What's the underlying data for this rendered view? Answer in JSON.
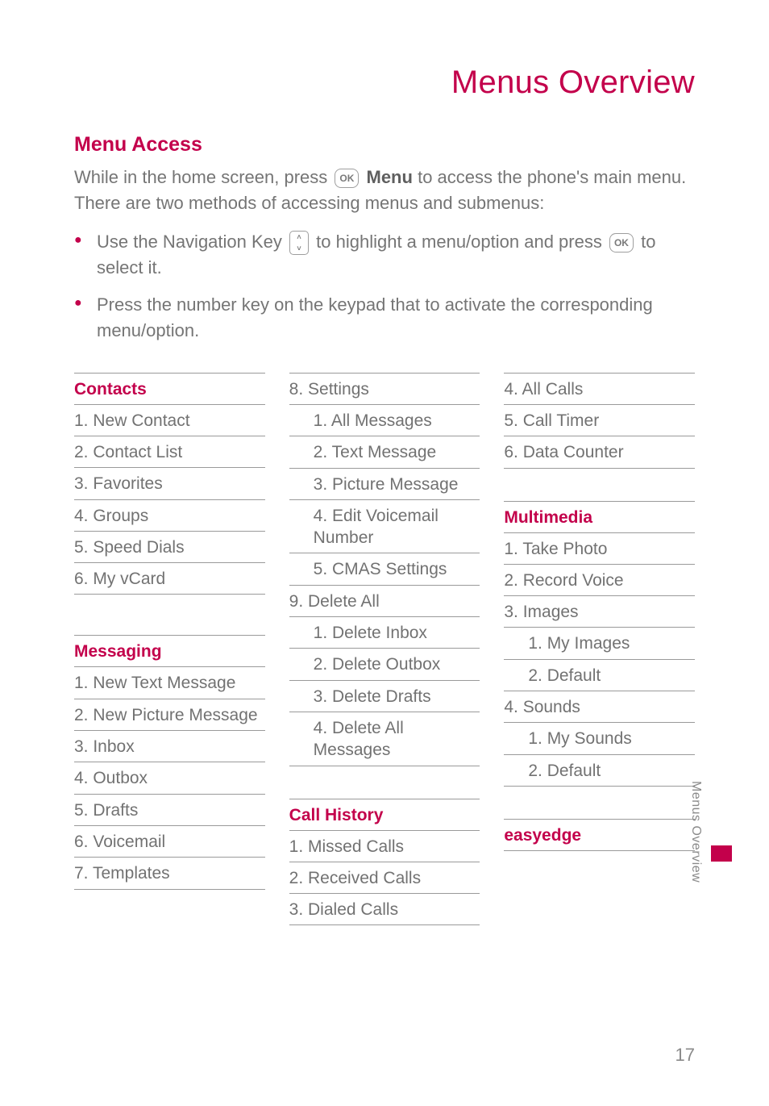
{
  "page": {
    "title": "Menus Overview",
    "section_heading": "Menu Access",
    "intro_before_icon": "While in the home screen, press ",
    "intro_icon_label": "OK",
    "intro_bold": " Menu",
    "intro_after_bold": " to access the phone's main menu. There are two methods of accessing menus and submenus:",
    "bullet1_a": "Use the Navigation Key ",
    "bullet1_b": " to highlight a menu/option and press ",
    "bullet1_c": " to select it.",
    "bullet2": "Press the number key on the keypad that to activate the corresponding menu/option.",
    "side_tab": "Menus Overview",
    "page_number": "17"
  },
  "col1": {
    "contacts": {
      "title": "Contacts",
      "items": [
        "1.  New Contact",
        "2.  Contact List",
        "3.  Favorites",
        "4.  Groups",
        "5.  Speed Dials",
        "6.  My vCard"
      ]
    },
    "messaging": {
      "title": "Messaging",
      "items": [
        "1.  New Text Message",
        "2.  New Picture Message",
        "3.  Inbox",
        "4.  Outbox",
        "5.  Drafts",
        "6.  Voicemail",
        "7.  Templates"
      ]
    }
  },
  "col2": {
    "settings": {
      "row": "8.  Settings",
      "sub": [
        "1. All Messages",
        "2. Text Message",
        "3. Picture Message",
        "4. Edit Voicemail Number",
        "5. CMAS Settings"
      ]
    },
    "delete_all": {
      "row": "9.  Delete All",
      "sub": [
        "1. Delete Inbox",
        "2. Delete Outbox",
        "3. Delete Drafts",
        "4. Delete All Messages"
      ]
    },
    "call_history": {
      "title": "Call History",
      "items": [
        "1.  Missed Calls",
        "2. Received Calls",
        "3. Dialed Calls"
      ]
    }
  },
  "col3": {
    "calls_cont": [
      "4. All Calls",
      "5. Call Timer",
      "6. Data Counter"
    ],
    "multimedia": {
      "title": "Multimedia",
      "rows": [
        {
          "text": "1.  Take Photo",
          "lvl": 1
        },
        {
          "text": "2.  Record Voice",
          "lvl": 1
        },
        {
          "text": "3.  Images",
          "lvl": 1
        },
        {
          "text": "1. My Images",
          "lvl": 2
        },
        {
          "text": "2. Default",
          "lvl": 2
        },
        {
          "text": "4.  Sounds",
          "lvl": 1
        },
        {
          "text": "1. My Sounds",
          "lvl": 2
        },
        {
          "text": "2. Default",
          "lvl": 2
        }
      ]
    },
    "easyedge": {
      "title": "easyedge"
    }
  }
}
